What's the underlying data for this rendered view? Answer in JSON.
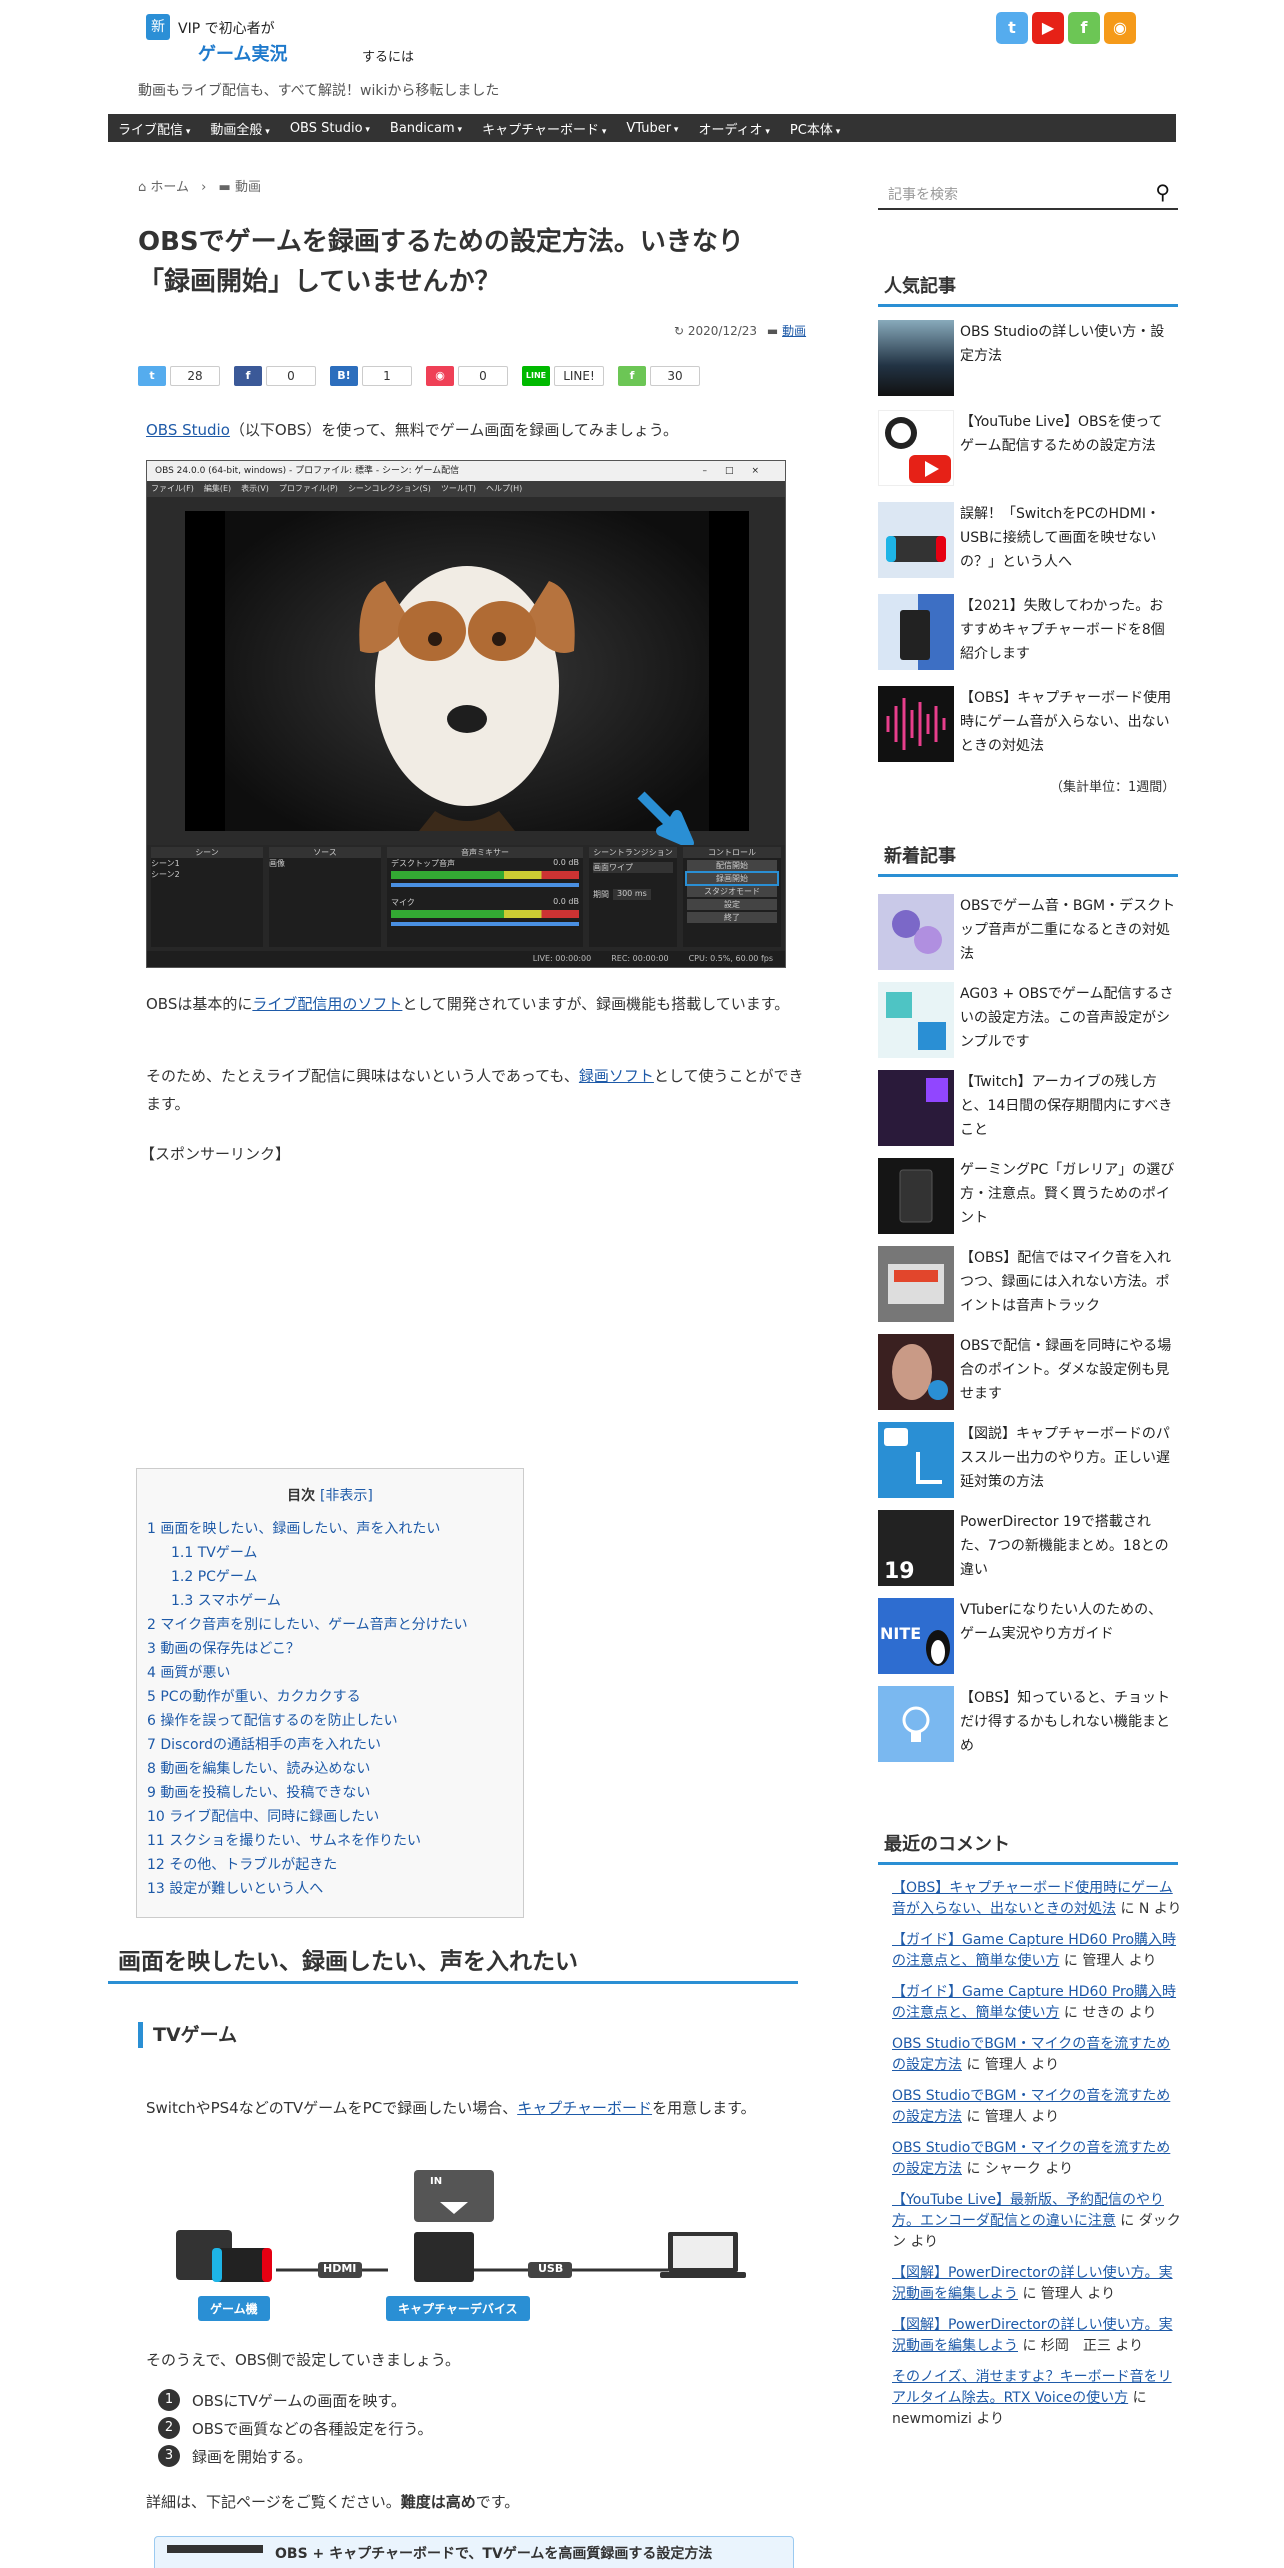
{
  "header": {
    "logo_badge": "新",
    "logo_line1": "VIP で初心者が",
    "logo_line2": "ゲーム実況",
    "logo_line3": "するには",
    "tagline": "動画もライブ配信も、すべて解説！wikiから移転しました",
    "social": [
      {
        "name": "twitter-icon",
        "color": "#55acee",
        "glyph": "t"
      },
      {
        "name": "youtube-icon",
        "color": "#e62117",
        "glyph": "▶"
      },
      {
        "name": "feedly-icon",
        "color": "#6cc655",
        "glyph": "f"
      },
      {
        "name": "rss-icon",
        "color": "#f59a1a",
        "glyph": "◉"
      }
    ]
  },
  "nav": [
    "ライブ配信",
    "動画全般",
    "OBS Studio",
    "Bandicam",
    "キャプチャーボード",
    "VTuber",
    "オーディオ",
    "PC本体"
  ],
  "breadcrumb": {
    "home": "ホーム",
    "sep": "›",
    "category": "動画"
  },
  "article": {
    "title": "OBSでゲームを録画するための設定方法。いきなり「録画開始」していませんか？",
    "date": "2020/12/23",
    "category": "動画",
    "shares": [
      {
        "name": "twitter",
        "label": "t",
        "color": "#55acee",
        "count": "28"
      },
      {
        "name": "facebook",
        "label": "f",
        "color": "#3b5998",
        "count": "0"
      },
      {
        "name": "hatena",
        "label": "B!",
        "color": "#2c6ebd",
        "count": "1"
      },
      {
        "name": "pocket",
        "label": "◉",
        "color": "#ef4056",
        "count": "0"
      },
      {
        "name": "line",
        "label": "LINE",
        "color": "#00b900",
        "count": "LINE!"
      },
      {
        "name": "feedly",
        "label": "f",
        "color": "#6cc655",
        "count": "30"
      }
    ],
    "intro_link": "OBS Studio",
    "intro_text": "（以下OBS）を使って、無料でゲーム画面を録画してみましょう。",
    "screenshot": {
      "title_bar": "OBS 24.0.0 (64-bit, windows) - プロファイル: 標準 - シーン: ゲーム配信",
      "menu": [
        "ファイル(F)",
        "編集(E)",
        "表示(V)",
        "プロファイル(P)",
        "シーンコレクション(S)",
        "ツール(T)",
        "ヘルプ(H)"
      ],
      "panels": [
        "シーン",
        "ソース",
        "音声ミキサー",
        "シーントランジション",
        "コントロール"
      ],
      "scenes": [
        "シーン1",
        "シーン2"
      ],
      "source": "画像",
      "mixer": [
        {
          "label": "デスクトップ音声",
          "db": "0.0 dB"
        },
        {
          "label": "マイク",
          "db": "0.0 dB"
        }
      ],
      "transition": "画面ワイプ",
      "duration_label": "期間",
      "duration": "300 ms",
      "controls": [
        "配信開始",
        "録画開始",
        "スタジオモード",
        "設定",
        "終了"
      ],
      "status": [
        "LIVE: 00:00:00",
        "REC: 00:00:00",
        "CPU: 0.5%, 60.00 fps"
      ]
    },
    "para2_pre": "OBSは基本的に",
    "para2_link": "ライブ配信用のソフト",
    "para2_post": "として開発されていますが、録画機能も搭載しています。",
    "para3_pre": "そのため、たとえライブ配信に興味はないという人であっても、",
    "para3_link": "録画ソフト",
    "para3_post": "として使うことができます。",
    "sponsor": "【スポンサーリンク】",
    "toc": {
      "title": "目次",
      "toggle": "[非表示]",
      "items": [
        {
          "label": "1 画面を映したい、録画したい、声を入れたい",
          "sub": false
        },
        {
          "label": "1.1 TVゲーム",
          "sub": true
        },
        {
          "label": "1.2 PCゲーム",
          "sub": true
        },
        {
          "label": "1.3 スマホゲーム",
          "sub": true
        },
        {
          "label": "2 マイク音声を別にしたい、ゲーム音声と分けたい",
          "sub": false
        },
        {
          "label": "3 動画の保存先はどこ？",
          "sub": false
        },
        {
          "label": "4 画質が悪い",
          "sub": false
        },
        {
          "label": "5 PCの動作が重い、カクカクする",
          "sub": false
        },
        {
          "label": "6 操作を誤って配信するのを防止したい",
          "sub": false
        },
        {
          "label": "7 Discordの通話相手の声を入れたい",
          "sub": false
        },
        {
          "label": "8 動画を編集したい、読み込めない",
          "sub": false
        },
        {
          "label": "9 動画を投稿したい、投稿できない",
          "sub": false
        },
        {
          "label": "10 ライブ配信中、同時に録画したい",
          "sub": false
        },
        {
          "label": "11 スクショを撮りたい、サムネを作りたい",
          "sub": false
        },
        {
          "label": "12 その他、トラブルが起きた",
          "sub": false
        },
        {
          "label": "13 設定が難しいという人へ",
          "sub": false
        }
      ]
    },
    "h2": "画面を映したい、録画したい、声を入れたい",
    "h3": "TVゲーム",
    "para4_pre": "SwitchやPS4などのTVゲームをPCで録画したい場合、",
    "para4_link": "キャプチャーボード",
    "para4_post": "を用意します。",
    "diagram": {
      "in": "IN",
      "hdmi": "HDMI",
      "usb": "USB",
      "game_label": "ゲーム機",
      "device_label": "キャプチャーデバイス"
    },
    "para5": "そのうえで、OBS側で設定していきましょう。",
    "steps": [
      "OBSにTVゲームの画面を映す。",
      "OBSで画質などの各種設定を行う。",
      "録画を開始する。"
    ],
    "para6_pre": "詳細は、下記ページをご覧ください。",
    "para6_bold": "難度は高め",
    "para6_post": "です。",
    "related_box": "OBS + キャプチャーボードで、TVゲームを高画質録画する設定方法"
  },
  "sidebar": {
    "search_placeholder": "記事を検索",
    "popular_title": "人気記事",
    "popular": [
      "OBS Studioの詳しい使い方・設定方法",
      "【YouTube Live】OBSを使ってゲーム配信するための設定方法",
      "誤解！「SwitchをPCのHDMI・USBに接続して画面を映せないの？」という人へ",
      "【2021】失敗してわかった。おすすめキャプチャーボードを8個紹介します",
      "【OBS】キャプチャーボード使用時にゲーム音が入らない、出ないときの対処法"
    ],
    "period": "（集計単位：1週間）",
    "new_title": "新着記事",
    "new": [
      "OBSでゲーム音・BGM・デスクトップ音声が二重になるときの対処法",
      "AG03 + OBSでゲーム配信するさいの設定方法。この音声設定がシンプルです",
      "【Twitch】アーカイブの残し方と、14日間の保存期間内にすべきこと",
      "ゲーミングPC「ガレリア」の選び方・注意点。賢く買うためのポイント",
      "【OBS】配信ではマイク音を入れつつ、録画には入れない方法。ポイントは音声トラック",
      "OBSで配信・録画を同時にやる場合のポイント。ダメな設定例も見せます",
      "【図説】キャプチャーボードのパススルー出力のやり方。正しい遅延対策の方法",
      "PowerDirector 19で搭載された、7つの新機能まとめ。18との違い",
      "VTuberになりたい人のための、ゲーム実況やり方ガイド",
      "【OBS】知っていると、チョットだけ得するかもしれない機能まとめ"
    ],
    "new_thumb_text": {
      "powerdirector": "19",
      "nite": "NITE"
    },
    "comments_title": "最近のコメント",
    "comments": [
      {
        "link": "【OBS】キャプチャーボード使用時にゲーム音が入らない、出ないときの対処法",
        "by": " に N より"
      },
      {
        "link": "【ガイド】Game Capture HD60 Pro購入時の注意点と、簡単な使い方",
        "by": " に 管理人 より"
      },
      {
        "link": "【ガイド】Game Capture HD60 Pro購入時の注意点と、簡単な使い方",
        "by": " に せきの より"
      },
      {
        "link": "OBS StudioでBGM・マイクの音を流すための設定方法",
        "by": " に 管理人 より"
      },
      {
        "link": "OBS StudioでBGM・マイクの音を流すための設定方法",
        "by": " に 管理人 より"
      },
      {
        "link": "OBS StudioでBGM・マイクの音を流すための設定方法",
        "by": " に シャーク より"
      },
      {
        "link": "【YouTube Live】最新版、予約配信のやり方。エンコーダ配信との違いに注意",
        "by": " に ダックン より"
      },
      {
        "link": "【図解】PowerDirectorの詳しい使い方。実況動画を編集しよう",
        "by": " に 管理人 より"
      },
      {
        "link": "【図解】PowerDirectorの詳しい使い方。実況動画を編集しよう",
        "by": " に 杉岡　正三 より"
      },
      {
        "link": "そのノイズ、消せますよ？キーボード音をリアルタイム除去。RTX Voiceの使い方",
        "by": " に newmomizi より"
      }
    ]
  }
}
